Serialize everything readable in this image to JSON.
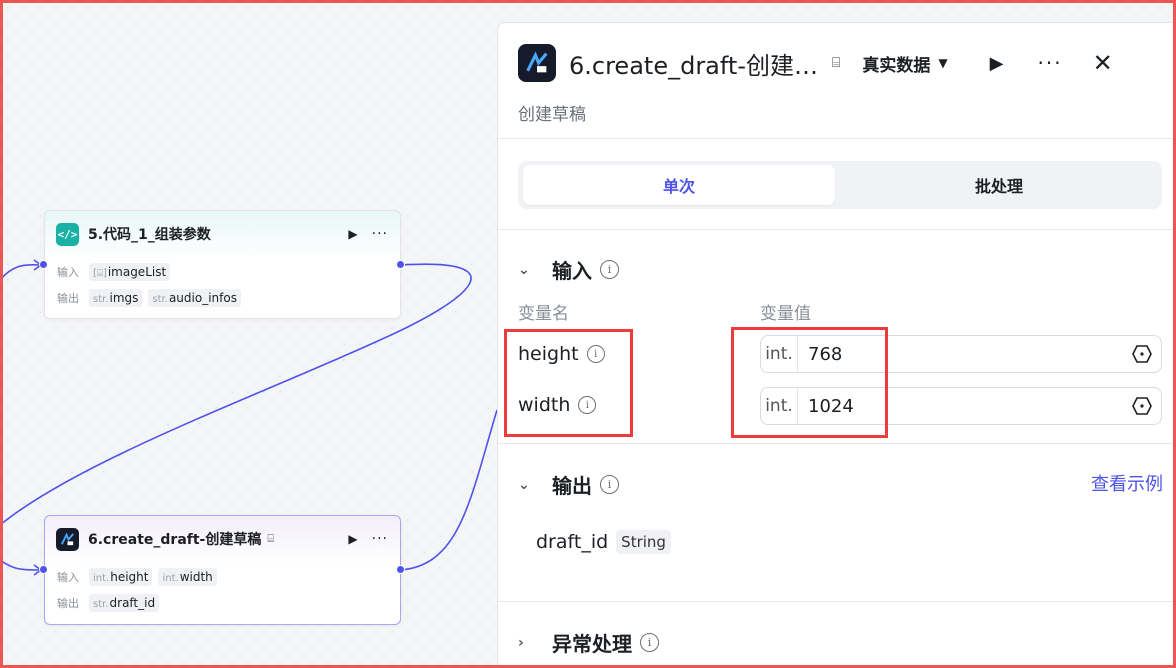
{
  "canvas": {
    "nodes": [
      {
        "title": "5.代码_1_组装参数",
        "input_label": "输入",
        "output_label": "输出",
        "inputs": [
          {
            "type": "[⌸]",
            "name": "imageList"
          }
        ],
        "outputs": [
          {
            "type": "str.",
            "name": "imgs"
          },
          {
            "type": "str.",
            "name": "audio_infos"
          }
        ]
      },
      {
        "title": "6.create_draft-创建草稿",
        "input_label": "输入",
        "output_label": "输出",
        "inputs": [
          {
            "type": "int.",
            "name": "height"
          },
          {
            "type": "int.",
            "name": "width"
          }
        ],
        "outputs": [
          {
            "type": "str.",
            "name": "draft_id"
          }
        ]
      }
    ]
  },
  "panel": {
    "title": "6.create_draft-创建…",
    "mode": "真实数据",
    "description": "创建草稿",
    "tabs": [
      "单次",
      "批处理"
    ],
    "input_section": {
      "title": "输入",
      "col_name": "变量名",
      "col_value": "变量值",
      "rows": [
        {
          "name": "height",
          "type": "int.",
          "value": "768"
        },
        {
          "name": "width",
          "type": "int.",
          "value": "1024"
        }
      ]
    },
    "output_section": {
      "title": "输出",
      "see_example": "查看示例",
      "rows": [
        {
          "name": "draft_id",
          "type": "String"
        }
      ]
    },
    "exception_section": {
      "title": "异常处理"
    }
  },
  "colors": {
    "accent": "#4d53e8",
    "highlight": "#ee3b3b",
    "teal": "#19b1a5"
  }
}
